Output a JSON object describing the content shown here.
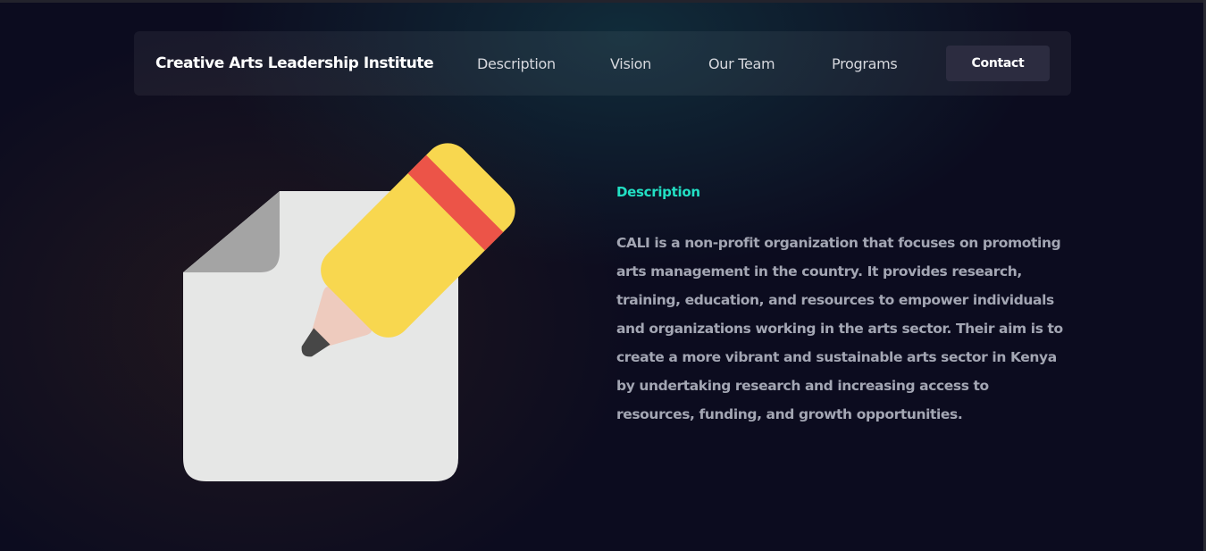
{
  "navbar": {
    "brand": "Creative Arts Leadership Institute",
    "links": [
      {
        "label": "Description"
      },
      {
        "label": "Vision"
      },
      {
        "label": "Our Team"
      },
      {
        "label": "Programs"
      }
    ],
    "contact_label": "Contact"
  },
  "hero": {
    "illustration_icon": "document-edit-pencil-icon",
    "section_label": "Description",
    "section_text": "CALI is a non-profit organization that focuses on promoting arts management in the country. It provides research, training, education, and resources to empower individuals and organizations working in the arts sector. Their aim is to create a more vibrant and sustainable arts sector in Kenya by undertaking research and increasing access to resources, funding, and growth opportunities."
  },
  "colors": {
    "background": "#0c0c1f",
    "accent": "#22e0c4",
    "body_text": "#a3a6b3",
    "contact_button": "#2c2c40",
    "paper": "#e6e7e6",
    "paper_fold": "#a4a4a4",
    "pencil_body": "#f8d74f",
    "pencil_band": "#ec5448",
    "pencil_wood": "#eecbbe",
    "pencil_lead": "#474747"
  }
}
